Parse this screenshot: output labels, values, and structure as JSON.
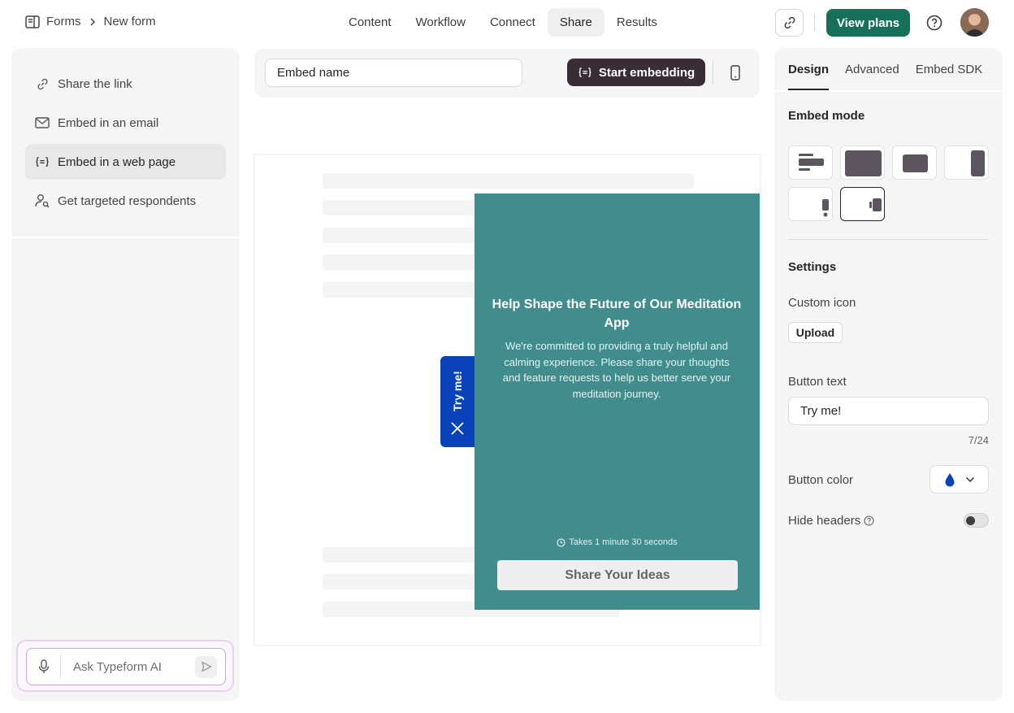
{
  "breadcrumb": {
    "root": "Forms",
    "current": "New form"
  },
  "nav": {
    "tabs": [
      "Content",
      "Workflow",
      "Connect",
      "Share",
      "Results"
    ],
    "active": "Share"
  },
  "header": {
    "view_plans": "View plans",
    "accent": "#17705a"
  },
  "sidebar": {
    "items": [
      {
        "label": "Share the link",
        "icon": "link-icon"
      },
      {
        "label": "Embed in an email",
        "icon": "mail-icon"
      },
      {
        "label": "Embed in a web page",
        "icon": "embed-code-icon",
        "active": true
      },
      {
        "label": "Get targeted respondents",
        "icon": "person-search-icon"
      }
    ],
    "ai_placeholder": "Ask Typeform AI"
  },
  "embed_bar": {
    "name_value": "Embed name",
    "start_label": "Start embedding"
  },
  "preview": {
    "title": "Help Shape the Future of Our Meditation App",
    "description": "We're committed to providing a truly helpful and calming experience. Please share your thoughts and feature requests to help us better serve your meditation journey.",
    "time": "Takes 1 minute 30 seconds",
    "cta": "Share Your Ideas",
    "trigger_label": "Try me!",
    "panel_color": "#418d8e",
    "trigger_color": "#0a43b9"
  },
  "right_panel": {
    "tabs": [
      "Design",
      "Advanced",
      "Embed SDK"
    ],
    "active_tab": "Design",
    "embed_mode_title": "Embed mode",
    "settings_title": "Settings",
    "custom_icon_label": "Custom icon",
    "upload_label": "Upload",
    "button_text_label": "Button text",
    "button_text_value": "Try me!",
    "counter": "7/24",
    "button_color_label": "Button color",
    "button_color": "#0a43b9",
    "hide_headers_label": "Hide headers",
    "hide_headers_on": false
  }
}
